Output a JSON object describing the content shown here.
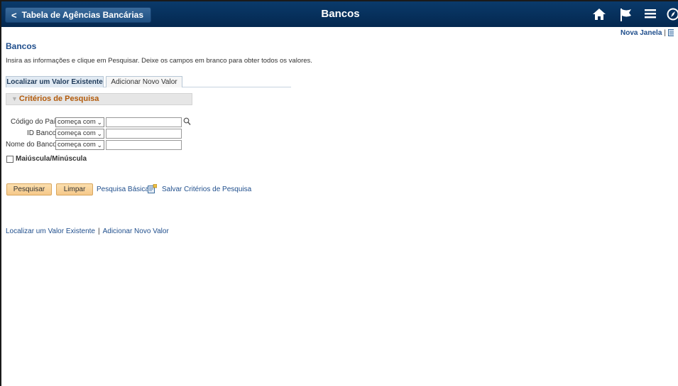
{
  "header": {
    "back_label": "Tabela de Agências Bancárias",
    "title": "Bancos",
    "icons": [
      "home-icon",
      "flag-icon",
      "menu-icon",
      "navbar-icon"
    ]
  },
  "top_links": {
    "new_window": "Nova Janela",
    "separator": "|"
  },
  "page": {
    "title": "Bancos",
    "instructions": "Insira as informações e clique em Pesquisar. Deixe os campos em branco para obter todos os valores."
  },
  "tabs": {
    "find": "Localizar um Valor Existente",
    "add": "Adicionar Novo Valor"
  },
  "criteria": {
    "header": "Critérios de Pesquisa",
    "fields": [
      {
        "label": "Código do País",
        "operator": "começa com",
        "value": ""
      },
      {
        "label": "ID Banco",
        "operator": "começa com",
        "value": ""
      },
      {
        "label": "Nome do Banco",
        "operator": "começa com",
        "value": ""
      }
    ],
    "case_label": "Maiúscula/Minúscula"
  },
  "actions": {
    "search": "Pesquisar",
    "clear": "Limpar",
    "basic_search": "Pesquisa Básica",
    "save_criteria": "Salvar Critérios de Pesquisa"
  },
  "bottom_links": {
    "find": "Localizar um Valor Existente",
    "separator": "|",
    "add": "Adicionar Novo Valor"
  },
  "colors": {
    "banner": "#04284f",
    "link": "#1f4e8c",
    "section_title": "#b25a0a",
    "button": "#f6c98a"
  }
}
